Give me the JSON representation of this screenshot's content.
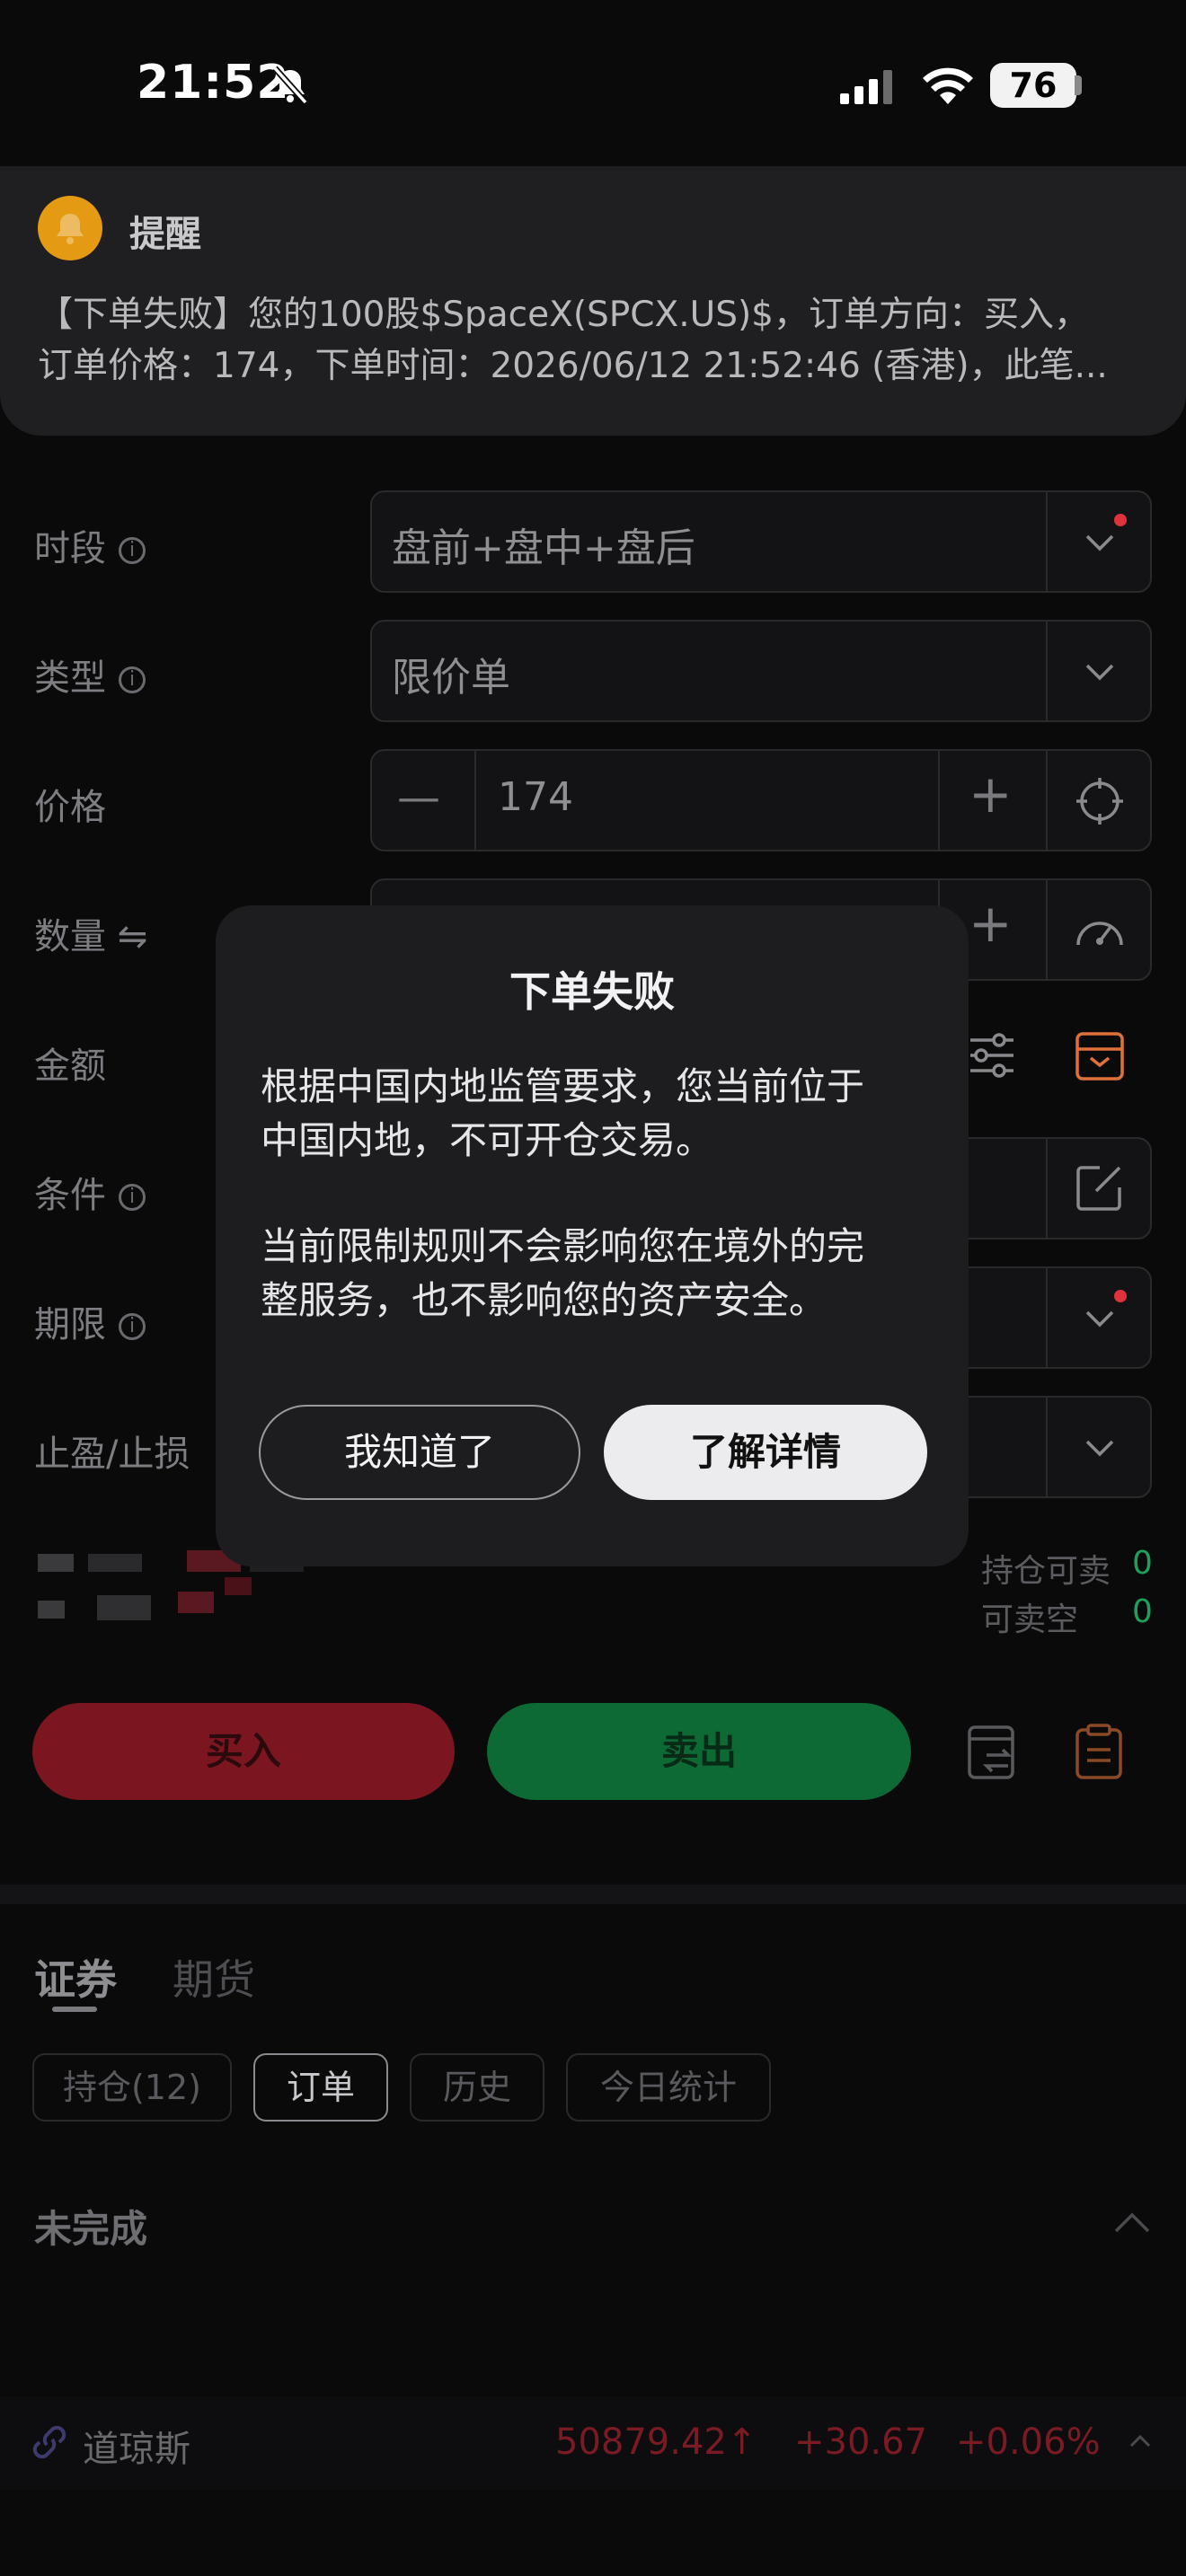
{
  "status_bar": {
    "time": "21:52",
    "battery": "76"
  },
  "notification": {
    "title": "提醒",
    "line1": "【下单失败】您的100股$SpaceX(SPCX.US)$，订单方向：买入，",
    "line2": "订单价格：174，下单时间：2026/06/12 21:52:46 (香港)，此笔..."
  },
  "form": {
    "session": {
      "label": "时段",
      "value": "盘前+盘中+盘后"
    },
    "type": {
      "label": "类型",
      "value": "限价单"
    },
    "price": {
      "label": "价格",
      "value": "174",
      "minus": "—",
      "plus": "+"
    },
    "quantity": {
      "label": "数量",
      "swap": "⇋"
    },
    "amount": {
      "label": "金额"
    },
    "condition": {
      "label": "条件"
    },
    "term": {
      "label": "期限"
    },
    "tp_sl": {
      "label": "止盈/止损"
    }
  },
  "modal": {
    "title": "下单失败",
    "para1_line1": "根据中国内地监管要求，您当前位于",
    "para1_line2": "中国内地，不可开仓交易。",
    "para2_line1": "当前限制规则不会影响您在境外的完",
    "para2_line2": "整服务，也不影响您的资产安全。",
    "btn_ok": "我知道了",
    "btn_details": "了解详情"
  },
  "positions": {
    "sellable_label": "持仓可卖",
    "sellable_value": "0",
    "short_label": "可卖空",
    "short_value": "0"
  },
  "actions": {
    "buy": "买入",
    "sell": "卖出"
  },
  "tabs": {
    "securities": "证券",
    "futures": "期货"
  },
  "chips": {
    "holdings": "持仓(12)",
    "orders": "订单",
    "history": "历史",
    "today": "今日统计"
  },
  "section": {
    "title": "未完成"
  },
  "ticker": {
    "name": "道琼斯",
    "price": "50879.42",
    "arrow": "↑",
    "change": "+30.67",
    "pct": "+0.06%"
  },
  "colors": {
    "accent_orange": "#e0703a",
    "buy_red": "#7b1620",
    "sell_green": "#0d6a34",
    "up_red": "#c0212e"
  }
}
